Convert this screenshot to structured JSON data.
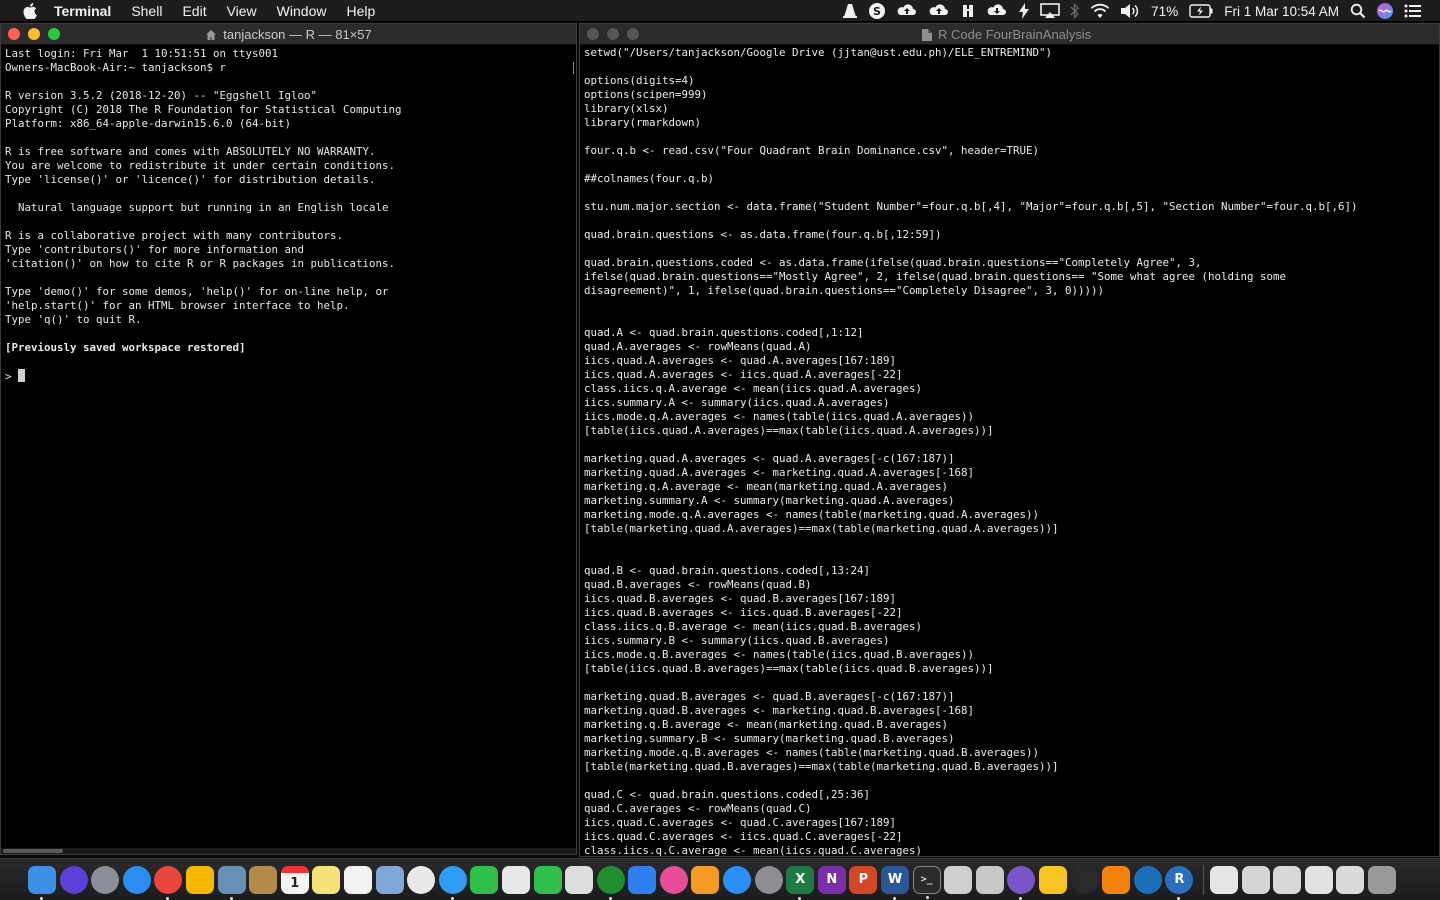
{
  "menubar": {
    "app_name": "Terminal",
    "items": [
      "Shell",
      "Edit",
      "View",
      "Window",
      "Help"
    ],
    "battery": "71%",
    "datetime": "Fri 1 Mar  10:54 AM"
  },
  "terminal": {
    "title": "tanjackson — R — 81×57",
    "lines": [
      "Last login: Fri Mar  1 10:51:51 on ttys001",
      "Owners-MacBook-Air:~ tanjackson$ r",
      "",
      "R version 3.5.2 (2018-12-20) -- \"Eggshell Igloo\"",
      "Copyright (C) 2018 The R Foundation for Statistical Computing",
      "Platform: x86_64-apple-darwin15.6.0 (64-bit)",
      "",
      "R is free software and comes with ABSOLUTELY NO WARRANTY.",
      "You are welcome to redistribute it under certain conditions.",
      "Type 'license()' or 'licence()' for distribution details.",
      "",
      "  Natural language support but running in an English locale",
      "",
      "R is a collaborative project with many contributors.",
      "Type 'contributors()' for more information and",
      "'citation()' on how to cite R or R packages in publications.",
      "",
      "Type 'demo()' for some demos, 'help()' for on-line help, or",
      "'help.start()' for an HTML browser interface to help.",
      "Type 'q()' to quit R.",
      ""
    ],
    "restored": "[Previously saved workspace restored]",
    "prompt": "> "
  },
  "editor": {
    "title": "R Code FourBrainAnalysis",
    "lines": [
      "setwd(\"/Users/tanjackson/Google Drive (jjtan@ust.edu.ph)/ELE_ENTREMIND\")",
      "",
      "options(digits=4)",
      "options(scipen=999)",
      "library(xlsx)",
      "library(rmarkdown)",
      "",
      "four.q.b <- read.csv(\"Four Quadrant Brain Dominance.csv\", header=TRUE)",
      "",
      "##colnames(four.q.b)",
      "",
      "stu.num.major.section <- data.frame(\"Student Number\"=four.q.b[,4], \"Major\"=four.q.b[,5], \"Section Number\"=four.q.b[,6])",
      "",
      "quad.brain.questions <- as.data.frame(four.q.b[,12:59])",
      "",
      "quad.brain.questions.coded <- as.data.frame(ifelse(quad.brain.questions==\"Completely Agree\", 3,",
      "ifelse(quad.brain.questions==\"Mostly Agree\", 2, ifelse(quad.brain.questions== \"Some what agree (holding some",
      "disagreement)\", 1, ifelse(quad.brain.questions==\"Completely Disagree\", 3, 0)))))",
      "",
      "",
      "quad.A <- quad.brain.questions.coded[,1:12]",
      "quad.A.averages <- rowMeans(quad.A)",
      "iics.quad.A.averages <- quad.A.averages[167:189]",
      "iics.quad.A.averages <- iics.quad.A.averages[-22]",
      "class.iics.q.A.average <- mean(iics.quad.A.averages)",
      "iics.summary.A <- summary(iics.quad.A.averages)",
      "iics.mode.q.A.averages <- names(table(iics.quad.A.averages))",
      "[table(iics.quad.A.averages)==max(table(iics.quad.A.averages))]",
      "",
      "marketing.quad.A.averages <- quad.A.averages[-c(167:187)]",
      "marketing.quad.A.averages <- marketing.quad.A.averages[-168]",
      "marketing.q.A.average <- mean(marketing.quad.A.averages)",
      "marketing.summary.A <- summary(marketing.quad.A.averages)",
      "marketing.mode.q.A.averages <- names(table(marketing.quad.A.averages))",
      "[table(marketing.quad.A.averages)==max(table(marketing.quad.A.averages))]",
      "",
      "",
      "quad.B <- quad.brain.questions.coded[,13:24]",
      "quad.B.averages <- rowMeans(quad.B)",
      "iics.quad.B.averages <- quad.B.averages[167:189]",
      "iics.quad.B.averages <- iics.quad.B.averages[-22]",
      "class.iics.q.B.average <- mean(iics.quad.B.averages)",
      "iics.summary.B <- summary(iics.quad.B.averages)",
      "iics.mode.q.B.averages <- names(table(iics.quad.B.averages))",
      "[table(iics.quad.B.averages)==max(table(iics.quad.B.averages))]",
      "",
      "marketing.quad.B.averages <- quad.B.averages[-c(167:187)]",
      "marketing.quad.B.averages <- marketing.quad.B.averages[-168]",
      "marketing.q.B.average <- mean(marketing.quad.B.averages)",
      "marketing.summary.B <- summary(marketing.quad.B.averages)",
      "marketing.mode.q.B.averages <- names(table(marketing.quad.B.averages))",
      "[table(marketing.quad.B.averages)==max(table(marketing.quad.B.averages))]",
      "",
      "quad.C <- quad.brain.questions.coded[,25:36]",
      "quad.C.averages <- rowMeans(quad.C)",
      "iics.quad.C.averages <- quad.C.averages[167:189]",
      "iics.quad.C.averages <- iics.quad.C.averages[-22]",
      "class.iics.q.C.average <- mean(iics.quad.C.averages)"
    ]
  },
  "dock": {
    "calendar_day": "1",
    "r_label": "R",
    "word_label": "W",
    "excel_label": "X",
    "powerpoint_label": "P",
    "onenote_label": "N",
    "icons": [
      {
        "name": "finder-icon",
        "color": "#3d8fe8"
      },
      {
        "name": "siri-icon",
        "color": "#5b3fd6"
      },
      {
        "name": "launchpad-icon",
        "color": "#8a8f99"
      },
      {
        "name": "safari-icon",
        "color": "#2d8cf0"
      },
      {
        "name": "chrome-icon",
        "color": "#e8453c"
      },
      {
        "name": "lightbulb-icon",
        "color": "#f5b800"
      },
      {
        "name": "preview-icon",
        "color": "#6a8fb5"
      },
      {
        "name": "notebook-icon",
        "color": "#b38a4a"
      },
      {
        "name": "calendar-icon",
        "color": "#f4f4f4"
      },
      {
        "name": "notes-icon",
        "color": "#f7e27a"
      },
      {
        "name": "reminders-icon",
        "color": "#f2f2f2"
      },
      {
        "name": "photos-preview-icon",
        "color": "#7fa8d6"
      },
      {
        "name": "photos-icon",
        "color": "#e9e9e9"
      },
      {
        "name": "messages-icon",
        "color": "#2f9cf5"
      },
      {
        "name": "facetime-icon",
        "color": "#2fbf4a"
      },
      {
        "name": "textedit-icon",
        "color": "#e8e8e8"
      },
      {
        "name": "numbers-icon",
        "color": "#2fbf4a"
      },
      {
        "name": "script-icon",
        "color": "#dddddd"
      },
      {
        "name": "spinner-icon",
        "color": "#1e8f2e"
      },
      {
        "name": "keynote-icon",
        "color": "#2f7ff0"
      },
      {
        "name": "itunes-icon",
        "color": "#e84d9a"
      },
      {
        "name": "ibooks-icon",
        "color": "#f59a23"
      },
      {
        "name": "appstore-icon",
        "color": "#2a8ef5"
      },
      {
        "name": "system-preferences-icon",
        "color": "#8d8d92"
      },
      {
        "name": "excel-icon",
        "color": "#1f7a43"
      },
      {
        "name": "onenote-icon",
        "color": "#7a2fa8"
      },
      {
        "name": "powerpoint-icon",
        "color": "#d24726"
      },
      {
        "name": "word-icon",
        "color": "#2b5797"
      },
      {
        "name": "terminal-icon",
        "color": "#2a2a2a"
      },
      {
        "name": "files-icon",
        "color": "#cfcfcf"
      },
      {
        "name": "screenshot-icon",
        "color": "#c8c8c8"
      },
      {
        "name": "viber-icon",
        "color": "#7b54c9"
      },
      {
        "name": "sketch-icon",
        "color": "#f7c325"
      },
      {
        "name": "xquartz-icon",
        "color": "#2a2a2a"
      },
      {
        "name": "vlc-icon",
        "color": "#f5820d"
      },
      {
        "name": "quicktime-icon",
        "color": "#1b6fb8"
      },
      {
        "name": "r-app-icon",
        "color": "#2a6ebd"
      },
      {
        "name": "document-icon",
        "color": "#e5e5e5"
      },
      {
        "name": "downloads-icon",
        "color": "#d5d5d5"
      },
      {
        "name": "window-icon-1",
        "color": "#d8d8d8"
      },
      {
        "name": "window-icon-2",
        "color": "#e2e2e2"
      },
      {
        "name": "window-icon-3",
        "color": "#dadada"
      },
      {
        "name": "trash-icon",
        "color": "#9a9a9a"
      }
    ]
  }
}
